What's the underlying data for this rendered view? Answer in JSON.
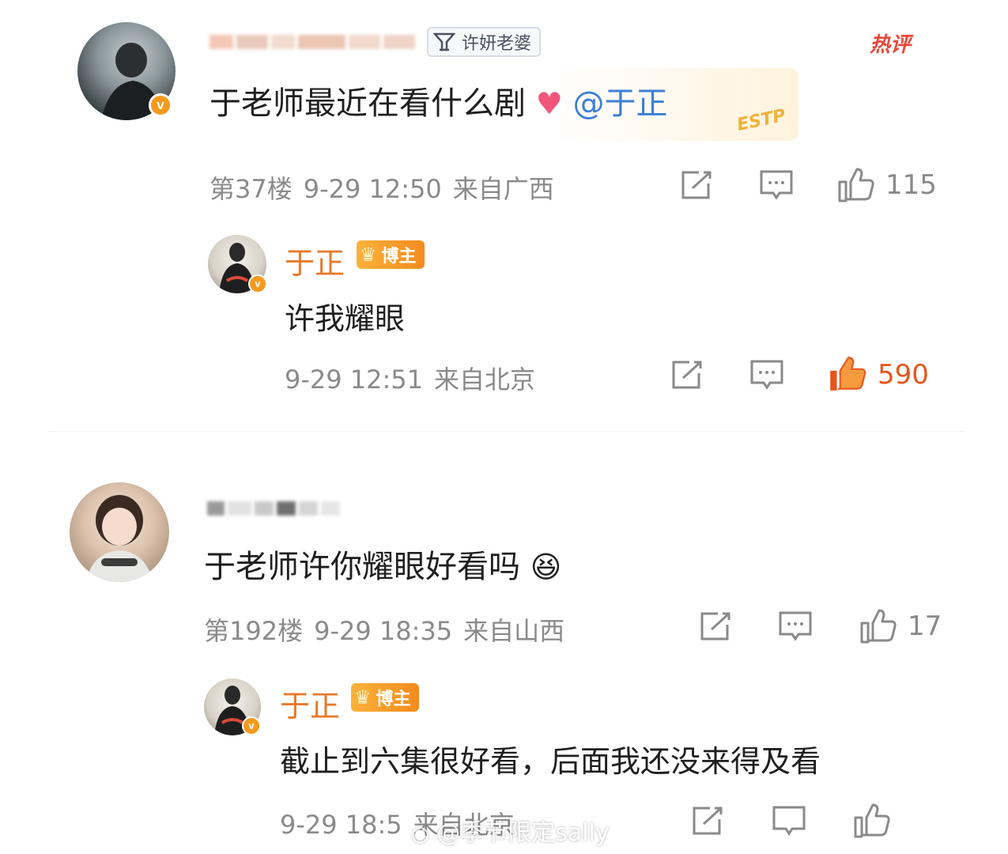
{
  "comments": [
    {
      "fan_badge": "许妍老婆",
      "hot_label": "热评",
      "text": "于老师最近在看什么剧",
      "mention": "@于正",
      "floor": "第37楼",
      "time": "9-29 12:50",
      "location": "来自广西",
      "likes": "115",
      "reply": {
        "name": "于正",
        "badge": "博主",
        "text": "许我耀眼",
        "time": "9-29 12:51",
        "location": "来自北京",
        "likes": "590"
      }
    },
    {
      "text": "于老师许你耀眼好看吗",
      "floor": "第192楼",
      "time": "9-29 18:35",
      "location": "来自山西",
      "likes": "17",
      "reply": {
        "name": "于正",
        "badge": "博主",
        "text": "截止到六集很好看，后面我还没来得及看",
        "time": "9-29 18:5",
        "location": "来自北京"
      }
    }
  ],
  "sticker_text": "ESTP",
  "watermark": "@季节限定sally",
  "colors": {
    "accent": "#e8792a",
    "like_active": "#e8541c",
    "mention": "#3d7fd6",
    "hot": "#e8473a"
  },
  "icons": [
    "share-icon",
    "comment-icon",
    "like-icon",
    "verified-icon",
    "crown-icon",
    "heart-emoji",
    "laughing-cry-emoji"
  ]
}
